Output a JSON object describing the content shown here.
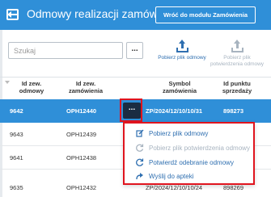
{
  "header": {
    "title": "Odmowy realizacji zamówień",
    "module_button": "Wróć do modułu Zamówienia"
  },
  "toolbar": {
    "search_placeholder": "Szukaj",
    "more_label": "...",
    "download_refusal": "Pobierz plik odmowy",
    "download_confirmation_line1": "Pobierz plik",
    "download_confirmation_line2": "potwierdzenia odmowy"
  },
  "table": {
    "headers": {
      "id_refusal_line1": "Id zew.",
      "id_refusal_line2": "odmowy",
      "id_order_line1": "Id zew.",
      "id_order_line2": "zamówienia",
      "symbol_line1": "Symbol",
      "symbol_line2": "zamówienia",
      "point_line1": "Id punktu",
      "point_line2": "sprzedaży"
    },
    "rows": [
      {
        "id_refusal": "9642",
        "id_order": "OPH12440",
        "symbol": "ZP/2024/12/10/10/31",
        "point": "898273"
      },
      {
        "id_refusal": "9643",
        "id_order": "OPH12439",
        "symbol": "",
        "point": ""
      },
      {
        "id_refusal": "9641",
        "id_order": "OPH12438",
        "symbol": "",
        "point": ""
      },
      {
        "id_refusal": "9635",
        "id_order": "OPH12432",
        "symbol": "ZP/2024/12/10/10/24",
        "point": "898269"
      }
    ],
    "row_actions_label": "..."
  },
  "context_menu": {
    "items": [
      {
        "label": "Pobierz plik odmowy",
        "enabled": true
      },
      {
        "label": "Pobierz plik potwierdzenia odmowy",
        "enabled": false
      },
      {
        "label": "Potwierdź odebranie odmowy",
        "enabled": true
      },
      {
        "label": "Wyślij do apteki",
        "enabled": true
      }
    ]
  },
  "colors": {
    "header_bg": "#2f8fd8",
    "selected_row": "#2f8fd8",
    "highlight": "#e0141e",
    "link_blue": "#2f6fb0",
    "disabled": "#a8b4c0"
  }
}
